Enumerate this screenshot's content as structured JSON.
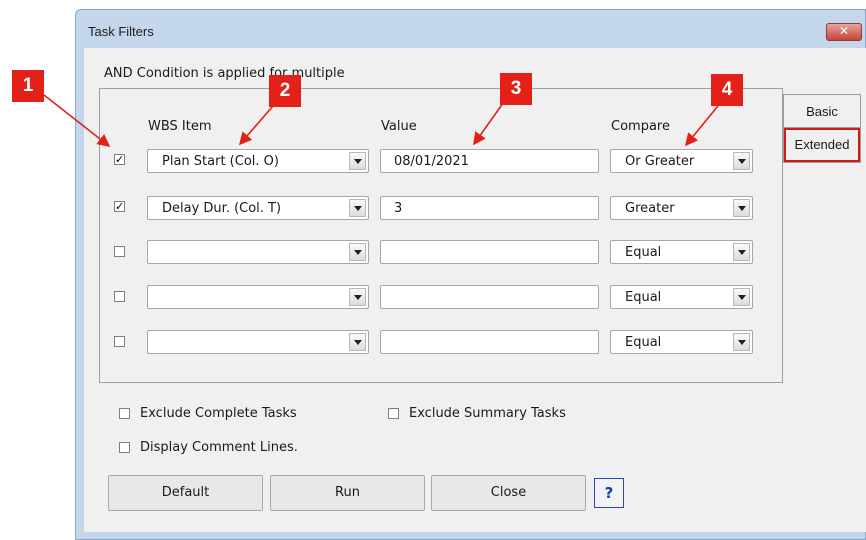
{
  "window": {
    "title": "Task Filters",
    "close_glyph": "✕"
  },
  "note": "AND Condition is applied for multiple",
  "tabs": [
    {
      "label": "Basic"
    },
    {
      "label": "Extended"
    }
  ],
  "columns": {
    "item": "WBS Item",
    "value": "Value",
    "compare": "Compare"
  },
  "rows": [
    {
      "checked": true,
      "item": "Plan Start  (Col. O)",
      "value": "08/01/2021",
      "compare": "Or Greater"
    },
    {
      "checked": true,
      "item": "Delay Dur.  (Col. T)",
      "value": "3",
      "compare": "Greater"
    },
    {
      "checked": false,
      "item": "",
      "value": "",
      "compare": "Equal"
    },
    {
      "checked": false,
      "item": "",
      "value": "",
      "compare": "Equal"
    },
    {
      "checked": false,
      "item": "",
      "value": "",
      "compare": "Equal"
    }
  ],
  "options": {
    "exclude_complete": "Exclude Complete Tasks",
    "exclude_summary": "Exclude Summary Tasks",
    "display_comments": "Display Comment Lines."
  },
  "buttons": {
    "default": "Default",
    "run": "Run",
    "close": "Close",
    "help": "?"
  },
  "callouts": [
    "1",
    "2",
    "3",
    "4"
  ],
  "colors": {
    "callout": "#e32119",
    "title_bar": "#c3d6ec",
    "help_text": "#1438c7"
  }
}
